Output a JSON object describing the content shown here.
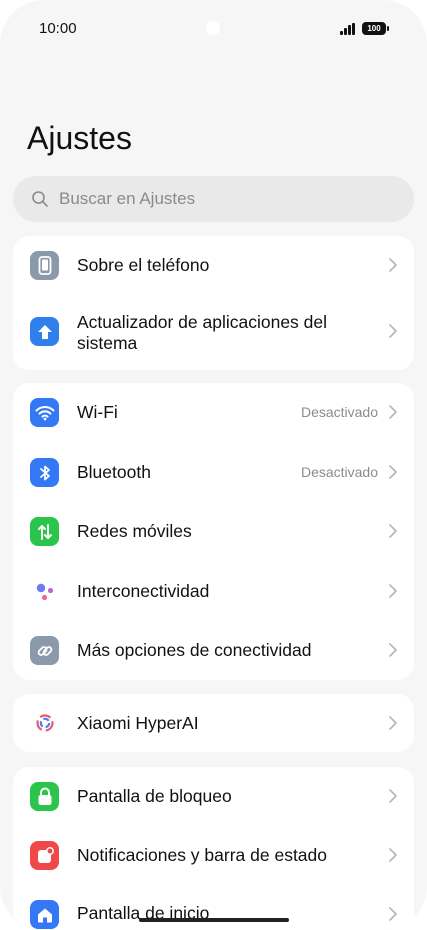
{
  "status": {
    "time": "10:00",
    "battery": "100"
  },
  "title": "Ajustes",
  "search": {
    "placeholder": "Buscar en Ajustes"
  },
  "groups": [
    [
      {
        "label": "Sobre el teléfono",
        "icon": "phone-icon",
        "color": "#8b9aab"
      },
      {
        "label": "Actualizador de aplicaciones del sistema",
        "icon": "arrow-up-icon",
        "color": "#2f80ed"
      }
    ],
    [
      {
        "label": "Wi-Fi",
        "value": "Desactivado",
        "icon": "wifi-icon",
        "color": "#3478f6"
      },
      {
        "label": "Bluetooth",
        "value": "Desactivado",
        "icon": "bluetooth-icon",
        "color": "#3478f6"
      },
      {
        "label": "Redes móviles",
        "icon": "mobile-data-icon",
        "color": "#2bc54b"
      },
      {
        "label": "Interconectividad",
        "icon": "interconnect-icon",
        "color": "#ffffff"
      },
      {
        "label": "Más opciones de conectividad",
        "icon": "link-icon",
        "color": "#8b9aab"
      }
    ],
    [
      {
        "label": "Xiaomi HyperAI",
        "icon": "hyperai-icon",
        "color": "#ffffff"
      }
    ],
    [
      {
        "label": "Pantalla de bloqueo",
        "icon": "lock-icon",
        "color": "#2bc54b"
      },
      {
        "label": "Notificaciones y barra de estado",
        "icon": "notification-icon",
        "color": "#f04848"
      },
      {
        "label": "Pantalla de inicio",
        "icon": "home-icon",
        "color": "#3478f6"
      }
    ]
  ]
}
